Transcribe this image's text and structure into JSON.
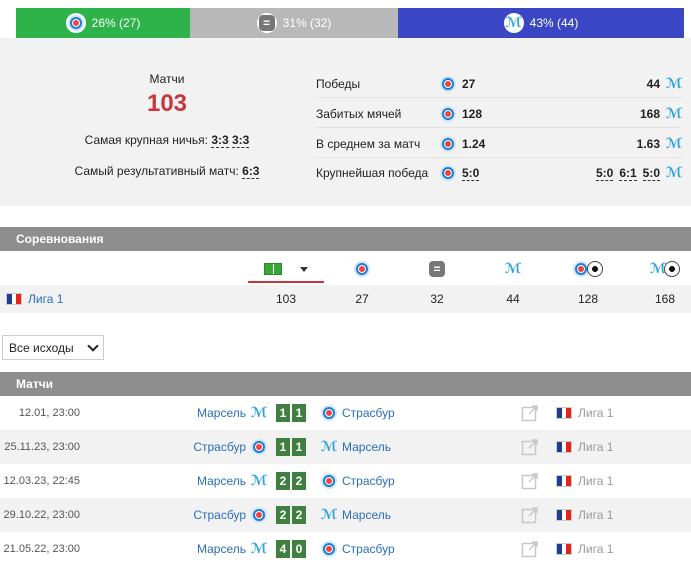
{
  "distribution": {
    "wins_label": "26% (27)",
    "draws_label": "31% (32)",
    "losses_label": "43% (44)",
    "colors": {
      "wins": "#2db34a",
      "draws": "#b8b8b8",
      "losses": "#3b46c4"
    }
  },
  "summary": {
    "matches_caption": "Матчи",
    "matches_total": "103",
    "biggest_draw_label": "Самая крупная ничья:",
    "biggest_draw_values": [
      "3:3",
      "3:3"
    ],
    "most_goals_label": "Самый результативный матч:",
    "most_goals_value": "6:3",
    "stats": [
      {
        "label": "Победы",
        "left": "27",
        "right": "44"
      },
      {
        "label": "Забитых мячей",
        "left": "128",
        "right": "168"
      },
      {
        "label": "В среднем за матч",
        "left": "1.24",
        "right": "1.63"
      },
      {
        "label": "Крупнейшая победа",
        "left": "5:0",
        "right_values": [
          "5:0",
          "6:1",
          "5:0"
        ]
      }
    ]
  },
  "competitions": {
    "section_title": "Соревнования",
    "rows": [
      {
        "name": "Лига 1",
        "total": "103",
        "wins": "27",
        "draws": "32",
        "losses": "44",
        "goals_home": "128",
        "goals_away": "168"
      }
    ]
  },
  "filter": {
    "selected": "Все исходы"
  },
  "matches": {
    "section_title": "Матчи",
    "rows": [
      {
        "date": "12.01, 23:00",
        "home": "Марсель",
        "home_icon": "om-icon",
        "home_score": "1",
        "away_score": "1",
        "away": "Страсбур",
        "away_icon": "strasbourg-icon",
        "league": "Лига 1"
      },
      {
        "date": "25.11.23, 23:00",
        "home": "Страсбур",
        "home_icon": "strasbourg-icon",
        "home_score": "1",
        "away_score": "1",
        "away": "Марсель",
        "away_icon": "om-icon",
        "league": "Лига 1"
      },
      {
        "date": "12.03.23, 22:45",
        "home": "Марсель",
        "home_icon": "om-icon",
        "home_score": "2",
        "away_score": "2",
        "away": "Страсбур",
        "away_icon": "strasbourg-icon",
        "league": "Лига 1"
      },
      {
        "date": "29.10.22, 23:00",
        "home": "Страсбур",
        "home_icon": "strasbourg-icon",
        "home_score": "2",
        "away_score": "2",
        "away": "Марсель",
        "away_icon": "om-icon",
        "league": "Лига 1"
      },
      {
        "date": "21.05.22, 23:00",
        "home": "Марсель",
        "home_icon": "om-icon",
        "home_score": "4",
        "away_score": "0",
        "away": "Страсбур",
        "away_icon": "strasbourg-icon",
        "league": "Лига 1"
      }
    ]
  }
}
